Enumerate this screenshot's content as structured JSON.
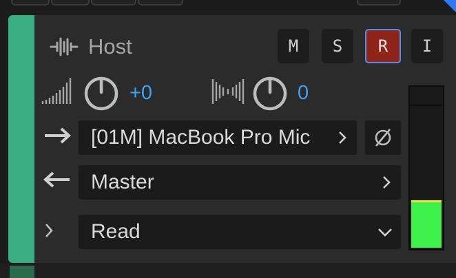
{
  "track": {
    "name": "Host",
    "color": "#39ad84"
  },
  "buttons": {
    "mute": "M",
    "solo": "S",
    "record": "R",
    "input_monitor": "I",
    "record_active_color": "#8f2419"
  },
  "controls": {
    "volume_value": "+0",
    "pan_value": "0"
  },
  "routing": {
    "input": "[01M] MacBook Pro Mic",
    "output": "Master"
  },
  "automation": {
    "mode": "Read"
  },
  "meter": {
    "level": 0.28,
    "fill_color": "#3ef04a",
    "peak_color": "#e8e81e"
  },
  "icons": {
    "track_type": "waveform-icon",
    "volume": "volume-ramp-icon",
    "pan": "pan-bars-icon",
    "input": "arrow-right-icon",
    "output": "arrow-left-icon",
    "phase": "phase-invert-icon",
    "expand": "chevron-right-icon",
    "dropdown": "chevron-down-icon"
  }
}
